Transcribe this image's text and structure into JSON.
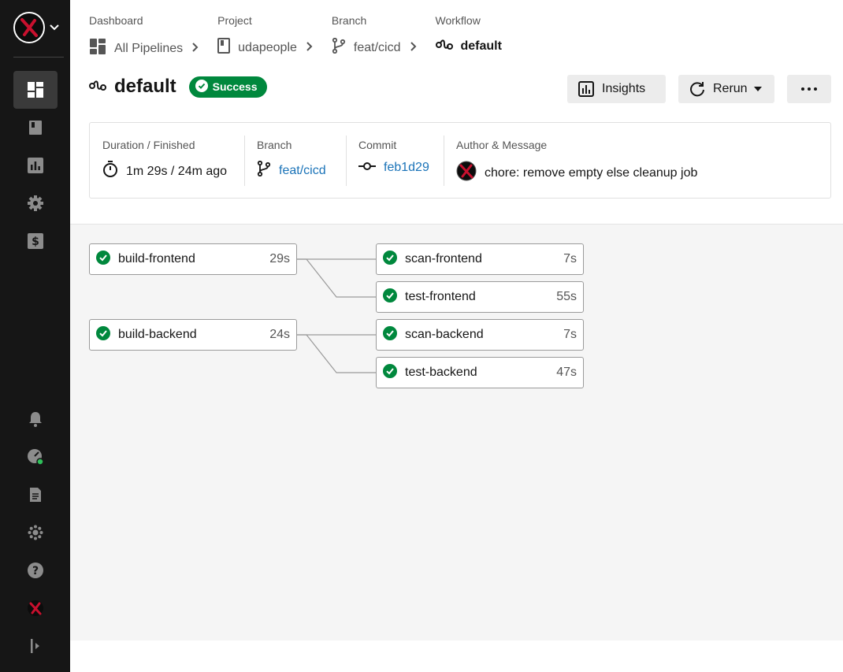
{
  "sidebar": {
    "items": [
      {
        "name": "dashboard",
        "icon": "dashboard-icon",
        "active": true
      },
      {
        "name": "projects",
        "icon": "book-icon"
      },
      {
        "name": "insights",
        "icon": "bar-chart-icon"
      },
      {
        "name": "organization-settings",
        "icon": "gear-icon"
      },
      {
        "name": "plan",
        "icon": "dollar-icon"
      }
    ],
    "bottom_items": [
      {
        "name": "notifications",
        "icon": "bell-icon"
      },
      {
        "name": "status",
        "icon": "status-gauge-icon"
      },
      {
        "name": "docs",
        "icon": "document-icon"
      },
      {
        "name": "integrations",
        "icon": "integrations-icon"
      },
      {
        "name": "support",
        "icon": "help-icon"
      },
      {
        "name": "profile",
        "icon": "user-avatar-icon"
      },
      {
        "name": "expand",
        "icon": "expand-sidebar-icon"
      }
    ]
  },
  "breadcrumbs": [
    {
      "label": "Dashboard",
      "value": "All Pipelines",
      "icon": "dashboard-icon"
    },
    {
      "label": "Project",
      "value": "udapeople",
      "icon": "book-icon"
    },
    {
      "label": "Branch",
      "value": "feat/cicd",
      "icon": "branch-icon"
    },
    {
      "label": "Workflow",
      "value": "default",
      "icon": "workflow-icon"
    }
  ],
  "header": {
    "title": "default",
    "status": "Success",
    "insights_label": "Insights",
    "rerun_label": "Rerun",
    "more_label": "..."
  },
  "info": {
    "duration_label": "Duration / Finished",
    "duration_value": "1m 29s / 24m ago",
    "branch_label": "Branch",
    "branch_value": "feat/cicd",
    "commit_label": "Commit",
    "commit_value": "feb1d29",
    "author_label": "Author & Message",
    "message": "chore: remove empty else cleanup job"
  },
  "jobs": [
    {
      "name": "build-frontend",
      "duration": "29s",
      "status": "success"
    },
    {
      "name": "scan-frontend",
      "duration": "7s",
      "status": "success"
    },
    {
      "name": "test-frontend",
      "duration": "55s",
      "status": "success"
    },
    {
      "name": "build-backend",
      "duration": "24s",
      "status": "success"
    },
    {
      "name": "scan-backend",
      "duration": "7s",
      "status": "success"
    },
    {
      "name": "test-backend",
      "duration": "47s",
      "status": "success"
    }
  ],
  "colors": {
    "sidebar_bg": "#161616",
    "success": "#00883d",
    "link": "#1a73b8"
  }
}
